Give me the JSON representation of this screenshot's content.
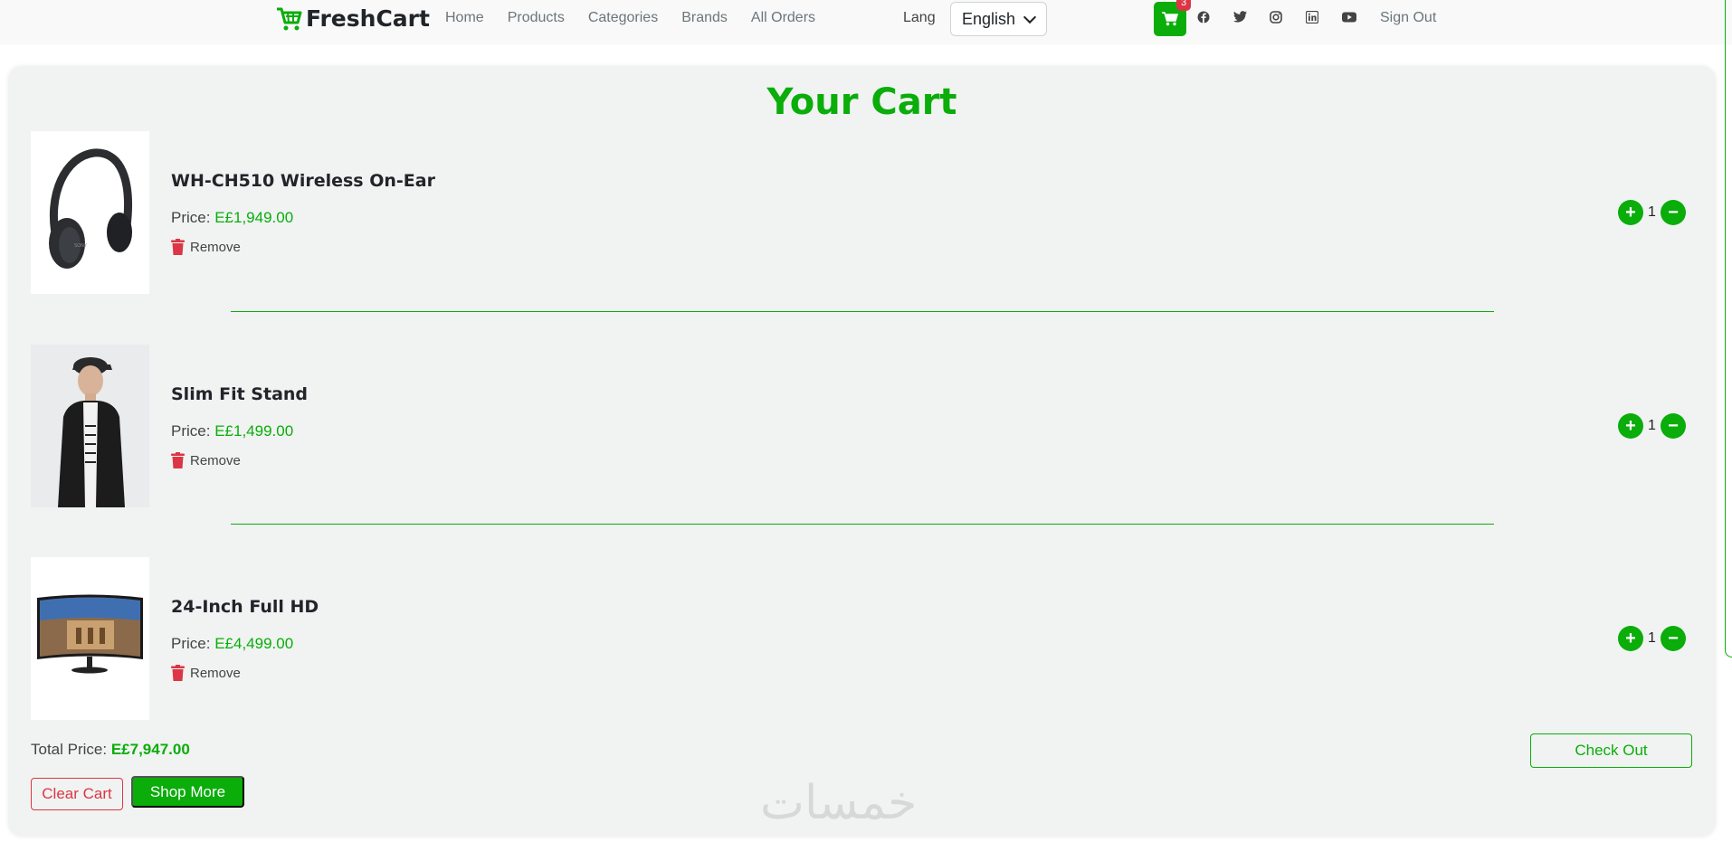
{
  "navbar": {
    "brand": "FreshCart",
    "links": [
      "Home",
      "Products",
      "Categories",
      "Brands",
      "All Orders"
    ],
    "lang_label": "Lang",
    "lang_value": "English",
    "cart_count": "3",
    "signout": "Sign Out",
    "social_icons": [
      "facebook-icon",
      "twitter-icon",
      "instagram-icon",
      "linkedin-icon",
      "youtube-icon"
    ]
  },
  "cart": {
    "title": "Your Cart",
    "price_label": "Price:",
    "remove_label": "Remove",
    "items": [
      {
        "name": "WH-CH510 Wireless On-Ear",
        "price": "E£1,949.00",
        "qty": "1",
        "image": "headphones"
      },
      {
        "name": "Slim Fit Stand",
        "price": "E£1,499.00",
        "qty": "1",
        "image": "leather-jacket"
      },
      {
        "name": "24-Inch Full HD",
        "price": "E£4,499.00",
        "qty": "1",
        "image": "monitor"
      }
    ],
    "total_label": "Total Price:",
    "total_value": "E£7,947.00",
    "checkout": "Check Out",
    "clear": "Clear Cart",
    "shop_more": "Shop More"
  },
  "watermark": "خمسات",
  "colors": {
    "accent": "#0aad0a",
    "danger": "#dc3545",
    "card_bg": "#f0f3f2"
  }
}
